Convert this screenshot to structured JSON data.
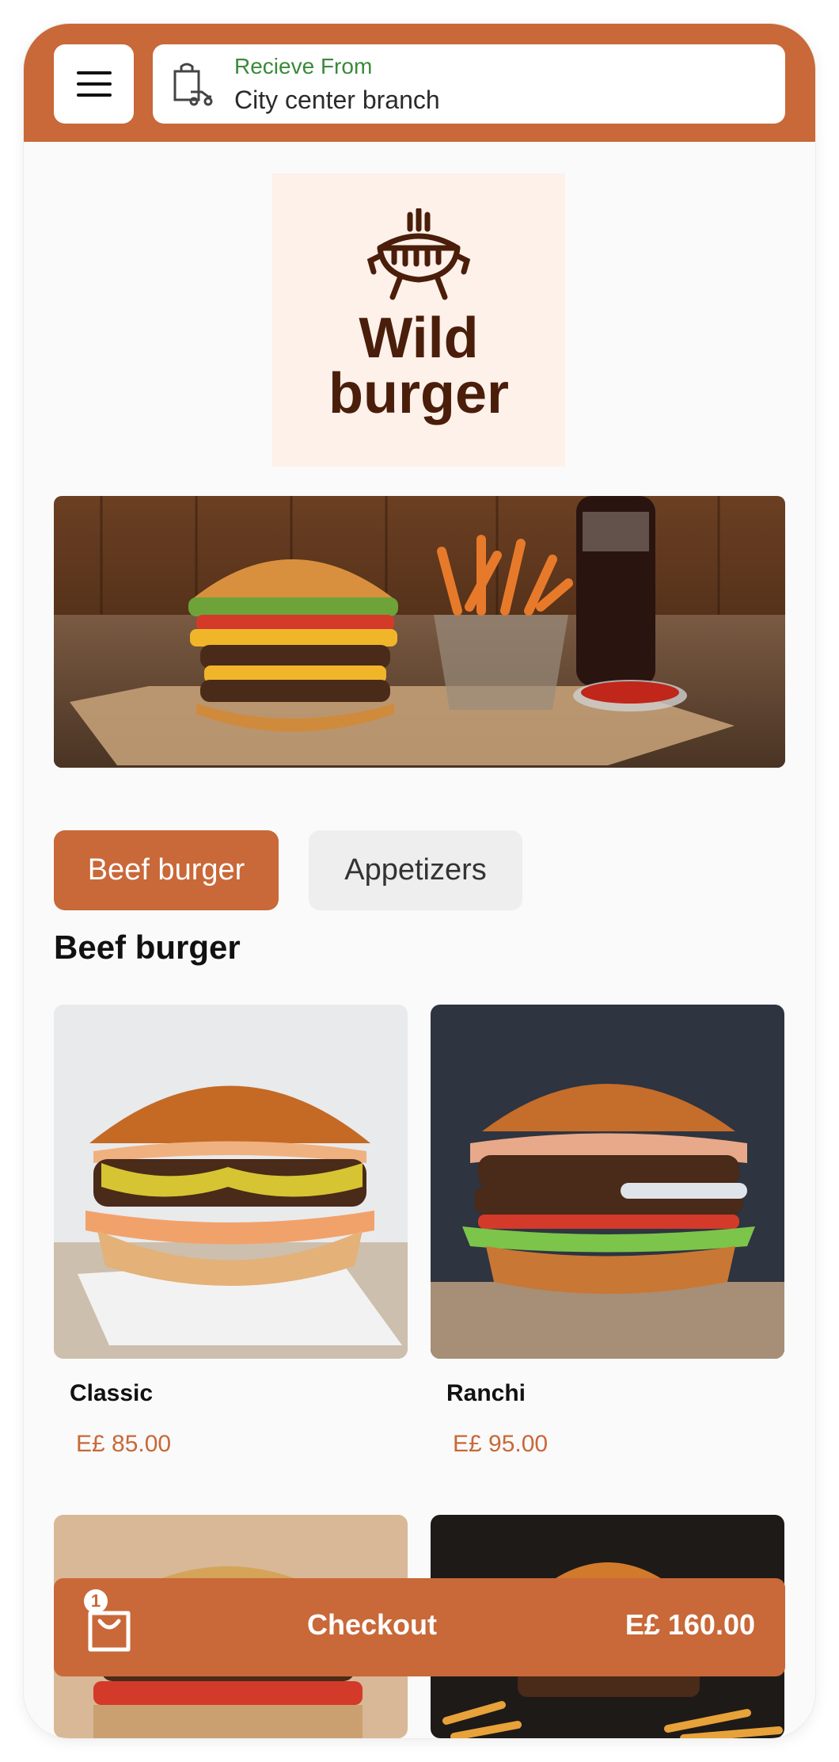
{
  "colors": {
    "accent": "#c96838",
    "receive_label": "#3a8a3a",
    "logo_bg": "#fdf1ea",
    "logo_text": "#4a1e0a"
  },
  "header": {
    "menu_icon": "hamburger-icon",
    "branch_icon": "takeaway-bag-icon",
    "receive_label": "Recieve From",
    "branch_name": "City center branch"
  },
  "brand": {
    "logo_icon": "grill-icon",
    "name_line1": "Wild",
    "name_line2": "burger"
  },
  "tabs": [
    {
      "label": "Beef burger",
      "active": true
    },
    {
      "label": "Appetizers",
      "active": false
    }
  ],
  "section": {
    "title": "Beef burger"
  },
  "products": [
    {
      "name": "Classic",
      "price": "E£ 85.00"
    },
    {
      "name": "Ranchi",
      "price": "E£ 95.00"
    }
  ],
  "checkout": {
    "cart_icon": "shopping-bag-icon",
    "item_count": "1",
    "label": "Checkout",
    "total": "E£  160.00"
  }
}
